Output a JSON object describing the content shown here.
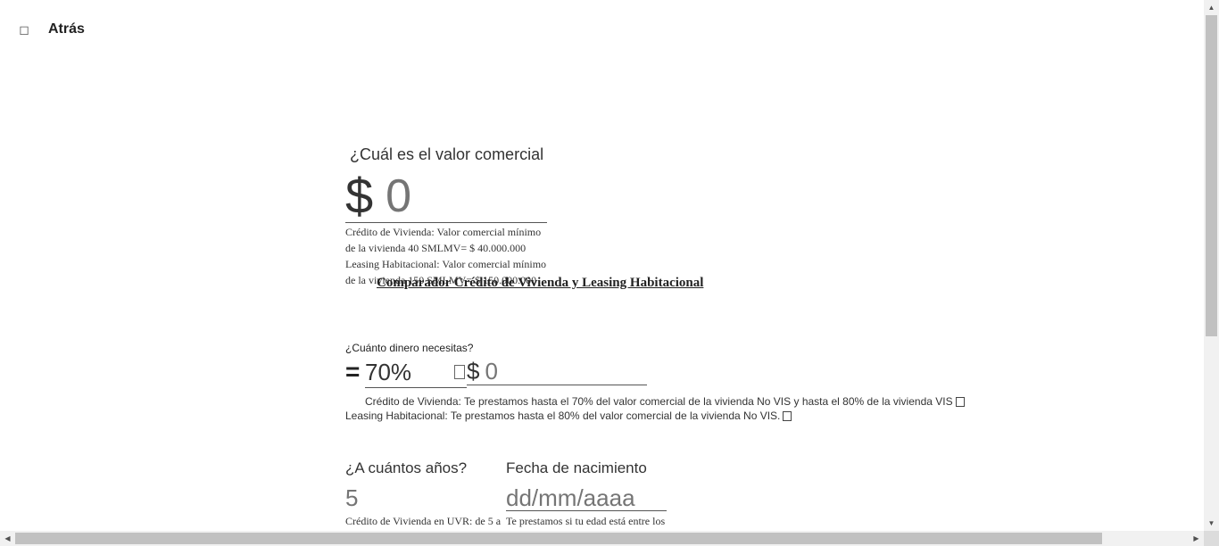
{
  "nav": {
    "back_icon": "◻",
    "back_label": "Atrás"
  },
  "value_section": {
    "question": "¿Cuál es el valor comercial de la vivienda?",
    "currency": "$",
    "placeholder": "0",
    "help_lines": [
      "Crédito de Vivienda: Valor comercial mínimo",
      "de la vivienda 40 SMLMV= $ 40.000.000",
      "Leasing Habitacional: Valor comercial mínimo",
      "de la vivienda 150 SMLMV= $ 150.000.000"
    ]
  },
  "comparador_title": "Comparador Crédito de Vivienda y Leasing Habitacional",
  "money_section": {
    "question": "¿Cuánto dinero necesitas?",
    "equals": "=",
    "percent": "70%",
    "currency": "$",
    "placeholder": "0",
    "help_line_1": "Crédito de Vivienda: Te prestamos hasta el 70% del valor comercial de la vivienda No VIS y hasta el 80% de la vivienda VIS",
    "help_line_2": "Leasing Habitacional: Te prestamos hasta el 80% del valor comercial de la vivienda No VIS."
  },
  "years_section": {
    "question": "¿A cuántos años?",
    "placeholder": "5",
    "help": "Crédito de Vivienda en UVR: de 5 a"
  },
  "birth_section": {
    "question": "Fecha de nacimiento",
    "placeholder": "dd/mm/aaaa",
    "help": "Te prestamos si tu edad está entre los"
  },
  "scrollbars": {
    "up": "▲",
    "down": "▼",
    "left": "◀",
    "right": "▶"
  }
}
